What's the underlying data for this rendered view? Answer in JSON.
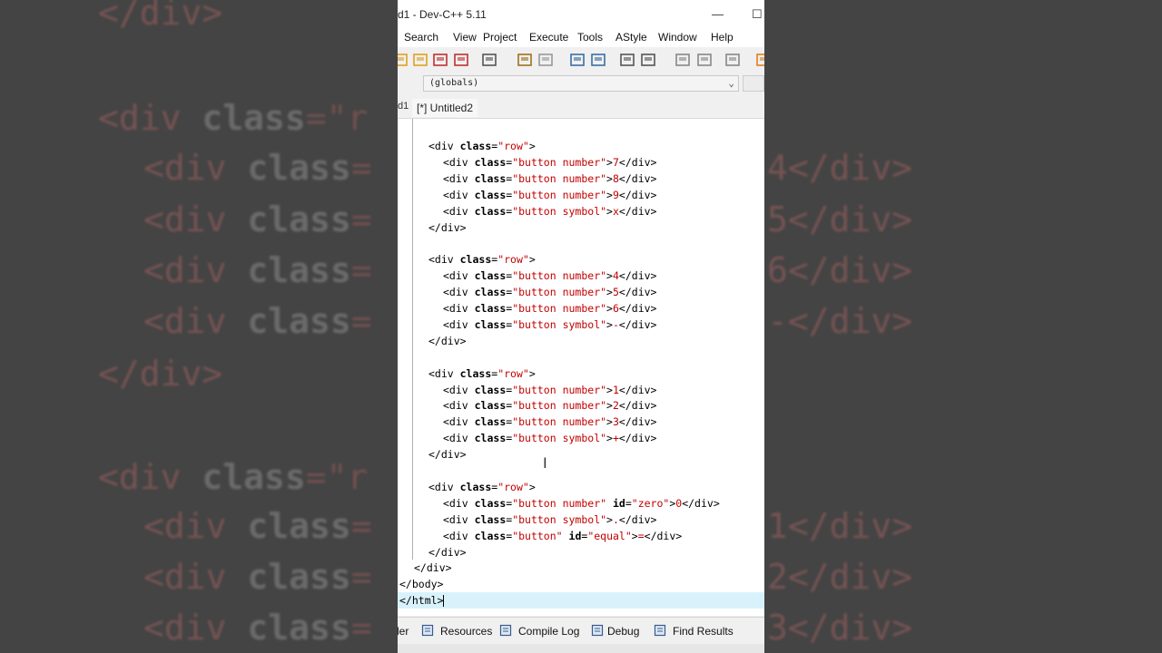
{
  "background": {
    "lines": [
      {
        "kind": "close",
        "text": "</div>"
      },
      {
        "kind": "open",
        "tag": "<div ",
        "kw": "class",
        "eq": "=\"r"
      },
      {
        "kind": "child",
        "tag": "<div ",
        "kw": "class",
        "eq": "=",
        "right": "4</div>"
      },
      {
        "kind": "child",
        "tag": "<div ",
        "kw": "class",
        "eq": "=",
        "right": "5</div>"
      },
      {
        "kind": "child",
        "tag": "<div ",
        "kw": "class",
        "eq": "=",
        "right": "6</div>"
      },
      {
        "kind": "child",
        "tag": "<div ",
        "kw": "class",
        "eq": "=",
        "right": "-</div>"
      },
      {
        "kind": "close",
        "text": "</div>"
      },
      {
        "kind": "open",
        "tag": "<div ",
        "kw": "class",
        "eq": "=\"r"
      },
      {
        "kind": "child",
        "tag": "<div ",
        "kw": "class",
        "eq": "=",
        "right": "1</div>"
      },
      {
        "kind": "child",
        "tag": "<div ",
        "kw": "class",
        "eq": "=",
        "right": "2</div>"
      },
      {
        "kind": "child",
        "tag": "<div ",
        "kw": "class",
        "eq": "=",
        "right": "3</div>"
      }
    ]
  },
  "window": {
    "title": "d1 - Dev-C++ 5.11",
    "minimize": "—",
    "maximize": "☐"
  },
  "menu": [
    "Search",
    "View",
    "Project",
    "Execute",
    "Tools",
    "AStyle",
    "Window",
    "Help"
  ],
  "toolbar": {
    "icons": [
      "save-all-icon",
      "save-icon",
      "close-file-icon",
      "close-all-icon",
      "print-icon",
      "undo-icon",
      "redo-icon",
      "find-icon",
      "replace-icon",
      "indent-icon",
      "unindent-icon",
      "bookmark-icon",
      "goto-icon",
      "debug-icon",
      "grid-icon"
    ]
  },
  "scope_combo": {
    "value": "(globals)"
  },
  "tabs": {
    "left_fragment": "d1",
    "active": "[*] Untitled2"
  },
  "code": [
    [
      [
        "t",
        "<div "
      ],
      [
        "k",
        "class"
      ],
      [
        "t",
        "="
      ],
      [
        "s",
        "\"row\""
      ],
      [
        "t",
        ">"
      ]
    ],
    [
      [
        "t",
        "  <div "
      ],
      [
        "k",
        "class"
      ],
      [
        "t",
        "="
      ],
      [
        "s",
        "\"button number\""
      ],
      [
        "t",
        ">"
      ],
      [
        "s",
        "7"
      ],
      [
        "t",
        "</div>"
      ]
    ],
    [
      [
        "t",
        "  <div "
      ],
      [
        "k",
        "class"
      ],
      [
        "t",
        "="
      ],
      [
        "s",
        "\"button number\""
      ],
      [
        "t",
        ">"
      ],
      [
        "s",
        "8"
      ],
      [
        "t",
        "</div>"
      ]
    ],
    [
      [
        "t",
        "  <div "
      ],
      [
        "k",
        "class"
      ],
      [
        "t",
        "="
      ],
      [
        "s",
        "\"button number\""
      ],
      [
        "t",
        ">"
      ],
      [
        "s",
        "9"
      ],
      [
        "t",
        "</div>"
      ]
    ],
    [
      [
        "t",
        "  <div "
      ],
      [
        "k",
        "class"
      ],
      [
        "t",
        "="
      ],
      [
        "s",
        "\"button symbol\""
      ],
      [
        "t",
        ">"
      ],
      [
        "s",
        "x"
      ],
      [
        "t",
        "</div>"
      ]
    ],
    [
      [
        "t",
        "</div>"
      ]
    ],
    [],
    [
      [
        "t",
        "<div "
      ],
      [
        "k",
        "class"
      ],
      [
        "t",
        "="
      ],
      [
        "s",
        "\"row\""
      ],
      [
        "t",
        ">"
      ]
    ],
    [
      [
        "t",
        "  <div "
      ],
      [
        "k",
        "class"
      ],
      [
        "t",
        "="
      ],
      [
        "s",
        "\"button number\""
      ],
      [
        "t",
        ">"
      ],
      [
        "s",
        "4"
      ],
      [
        "t",
        "</div>"
      ]
    ],
    [
      [
        "t",
        "  <div "
      ],
      [
        "k",
        "class"
      ],
      [
        "t",
        "="
      ],
      [
        "s",
        "\"button number\""
      ],
      [
        "t",
        ">"
      ],
      [
        "s",
        "5"
      ],
      [
        "t",
        "</div>"
      ]
    ],
    [
      [
        "t",
        "  <div "
      ],
      [
        "k",
        "class"
      ],
      [
        "t",
        "="
      ],
      [
        "s",
        "\"button number\""
      ],
      [
        "t",
        ">"
      ],
      [
        "s",
        "6"
      ],
      [
        "t",
        "</div>"
      ]
    ],
    [
      [
        "t",
        "  <div "
      ],
      [
        "k",
        "class"
      ],
      [
        "t",
        "="
      ],
      [
        "s",
        "\"button symbol\""
      ],
      [
        "t",
        ">"
      ],
      [
        "s",
        "-"
      ],
      [
        "t",
        "</div>"
      ]
    ],
    [
      [
        "t",
        "</div>"
      ]
    ],
    [],
    [
      [
        "t",
        "<div "
      ],
      [
        "k",
        "class"
      ],
      [
        "t",
        "="
      ],
      [
        "s",
        "\"row\""
      ],
      [
        "t",
        ">"
      ]
    ],
    [
      [
        "t",
        "  <div "
      ],
      [
        "k",
        "class"
      ],
      [
        "t",
        "="
      ],
      [
        "s",
        "\"button number\""
      ],
      [
        "t",
        ">"
      ],
      [
        "s",
        "1"
      ],
      [
        "t",
        "</div>"
      ]
    ],
    [
      [
        "t",
        "  <div "
      ],
      [
        "k",
        "class"
      ],
      [
        "t",
        "="
      ],
      [
        "s",
        "\"button number\""
      ],
      [
        "t",
        ">"
      ],
      [
        "s",
        "2"
      ],
      [
        "t",
        "</div>"
      ]
    ],
    [
      [
        "t",
        "  <div "
      ],
      [
        "k",
        "class"
      ],
      [
        "t",
        "="
      ],
      [
        "s",
        "\"button number\""
      ],
      [
        "t",
        ">"
      ],
      [
        "s",
        "3"
      ],
      [
        "t",
        "</div>"
      ]
    ],
    [
      [
        "t",
        "  <div "
      ],
      [
        "k",
        "class"
      ],
      [
        "t",
        "="
      ],
      [
        "s",
        "\"button symbol\""
      ],
      [
        "t",
        ">"
      ],
      [
        "s",
        "+"
      ],
      [
        "t",
        "</div>"
      ]
    ],
    [
      [
        "t",
        "</div>"
      ]
    ],
    [],
    [
      [
        "t",
        "<div "
      ],
      [
        "k",
        "class"
      ],
      [
        "t",
        "="
      ],
      [
        "s",
        "\"row\""
      ],
      [
        "t",
        ">"
      ]
    ],
    [
      [
        "t",
        "  <div "
      ],
      [
        "k",
        "class"
      ],
      [
        "t",
        "="
      ],
      [
        "s",
        "\"button number\""
      ],
      [
        "t",
        " "
      ],
      [
        "k",
        "id"
      ],
      [
        "t",
        "="
      ],
      [
        "s",
        "\"zero\""
      ],
      [
        "t",
        ">"
      ],
      [
        "s",
        "0"
      ],
      [
        "t",
        "</div>"
      ]
    ],
    [
      [
        "t",
        "  <div "
      ],
      [
        "k",
        "class"
      ],
      [
        "t",
        "="
      ],
      [
        "s",
        "\"button symbol\""
      ],
      [
        "t",
        ">"
      ],
      [
        "s",
        "."
      ],
      [
        "t",
        "</div>"
      ]
    ],
    [
      [
        "t",
        "  <div "
      ],
      [
        "k",
        "class"
      ],
      [
        "t",
        "="
      ],
      [
        "s",
        "\"button\""
      ],
      [
        "t",
        " "
      ],
      [
        "k",
        "id"
      ],
      [
        "t",
        "="
      ],
      [
        "s",
        "\"equal\""
      ],
      [
        "t",
        ">"
      ],
      [
        "s",
        "="
      ],
      [
        "t",
        "</div>"
      ]
    ],
    [
      [
        "t",
        "</div>"
      ]
    ],
    [
      [
        "t",
        "</div>"
      ]
    ],
    [
      [
        "t",
        "</body>"
      ]
    ],
    [
      [
        "t",
        "</html>"
      ]
    ]
  ],
  "bottom_tabs": [
    {
      "label": "ler",
      "icon": ""
    },
    {
      "label": "Resources",
      "icon": "resources-icon"
    },
    {
      "label": "Compile Log",
      "icon": "compile-log-icon"
    },
    {
      "label": "Debug",
      "icon": "debug-check-icon"
    },
    {
      "label": "Find Results",
      "icon": "find-results-icon"
    }
  ],
  "colors": {
    "tag": "#000000",
    "attribute": "#000000",
    "string": "#c20000",
    "current_line": "#d8f2fb"
  }
}
